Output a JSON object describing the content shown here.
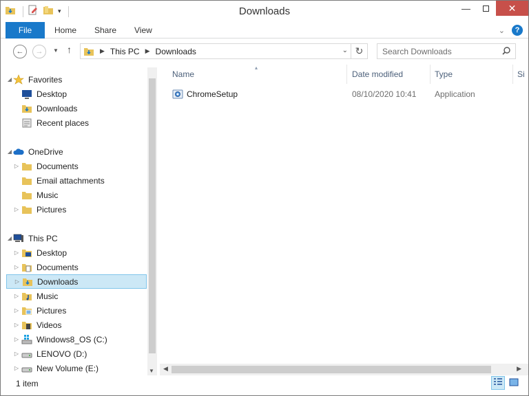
{
  "window": {
    "title": "Downloads"
  },
  "ribbon": {
    "tabs": [
      "File",
      "Home",
      "Share",
      "View"
    ]
  },
  "address": {
    "crumbs": [
      "This PC",
      "Downloads"
    ]
  },
  "search": {
    "placeholder": "Search Downloads"
  },
  "nav": {
    "favorites": {
      "label": "Favorites",
      "items": [
        "Desktop",
        "Downloads",
        "Recent places"
      ]
    },
    "onedrive": {
      "label": "OneDrive",
      "items": [
        "Documents",
        "Email attachments",
        "Music",
        "Pictures"
      ]
    },
    "thispc": {
      "label": "This PC",
      "items": [
        "Desktop",
        "Documents",
        "Downloads",
        "Music",
        "Pictures",
        "Videos",
        "Windows8_OS (C:)",
        "LENOVO (D:)",
        "New Volume (E:)"
      ]
    },
    "selected": "Downloads"
  },
  "columns": {
    "name": "Name",
    "date": "Date modified",
    "type": "Type",
    "size": "Si"
  },
  "files": [
    {
      "name": "ChromeSetup",
      "date": "08/10/2020 10:41",
      "type": "Application"
    }
  ],
  "status": {
    "count": "1 item"
  },
  "colors": {
    "accent": "#1979ca",
    "selection": "#cce8f6",
    "close": "#c7504a"
  }
}
